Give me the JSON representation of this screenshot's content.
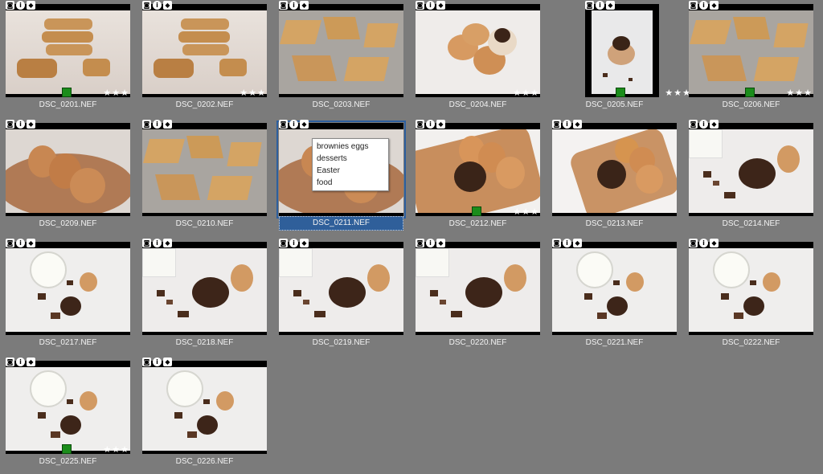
{
  "thumbnails": [
    {
      "filename": "DSC_0201.NEF",
      "scene": "scones-stack",
      "pick": true,
      "stars": 3
    },
    {
      "filename": "DSC_0202.NEF",
      "scene": "scones-stack",
      "pick": false,
      "stars": 3
    },
    {
      "filename": "DSC_0203.NEF",
      "scene": "scones-tray",
      "pick": false,
      "stars": 0
    },
    {
      "filename": "DSC_0204.NEF",
      "scene": "eggs-paper",
      "pick": false,
      "stars": 3
    },
    {
      "filename": "DSC_0205.NEF",
      "scene": "egg-portrait",
      "pick": true,
      "stars": 3
    },
    {
      "filename": "DSC_0206.NEF",
      "scene": "scones-tray",
      "pick": true,
      "stars": 3
    },
    {
      "filename": "DSC_0209.NEF",
      "scene": "eggs-plate",
      "pick": false,
      "stars": 0
    },
    {
      "filename": "DSC_0210.NEF",
      "scene": "scones-tray",
      "pick": false,
      "stars": 0
    },
    {
      "filename": "DSC_0211.NEF",
      "scene": "eggs-plate",
      "pick": false,
      "stars": 0,
      "selected": true
    },
    {
      "filename": "DSC_0212.NEF",
      "scene": "eggs-dish",
      "pick": true,
      "stars": 3
    },
    {
      "filename": "DSC_0213.NEF",
      "scene": "eggs-dish-white",
      "pick": false,
      "stars": 0
    },
    {
      "filename": "DSC_0214.NEF",
      "scene": "brownie-milk",
      "pick": false,
      "stars": 0
    },
    {
      "filename": "DSC_0217.NEF",
      "scene": "milk-top",
      "pick": false,
      "stars": 0
    },
    {
      "filename": "DSC_0218.NEF",
      "scene": "brownie-milk",
      "pick": false,
      "stars": 0
    },
    {
      "filename": "DSC_0219.NEF",
      "scene": "brownie-milk",
      "pick": false,
      "stars": 0
    },
    {
      "filename": "DSC_0220.NEF",
      "scene": "brownie-milk",
      "pick": false,
      "stars": 0
    },
    {
      "filename": "DSC_0221.NEF",
      "scene": "milk-top",
      "pick": false,
      "stars": 0
    },
    {
      "filename": "DSC_0222.NEF",
      "scene": "milk-top",
      "pick": false,
      "stars": 0
    },
    {
      "filename": "DSC_0225.NEF",
      "scene": "milk-top",
      "pick": true,
      "stars": 3
    },
    {
      "filename": "DSC_0226.NEF",
      "scene": "milk-top",
      "pick": false,
      "stars": 0
    }
  ],
  "tooltip": {
    "keywords": [
      "brownies eggs",
      "desserts",
      "Easter",
      "food"
    ]
  },
  "icons": [
    "camera-icon",
    "info-icon",
    "tag-icon"
  ],
  "glyphs": {
    "star": "★",
    "info": "i",
    "camera": "◙",
    "tag": "◆"
  },
  "colors": {
    "background": "#7b7b7b",
    "selection": "#2f5f9a",
    "pick": "#1b8d1b"
  }
}
